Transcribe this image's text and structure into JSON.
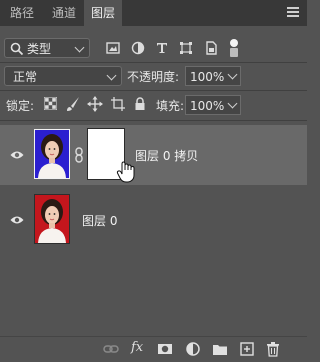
{
  "tabs": [
    {
      "label": "路径",
      "active": false
    },
    {
      "label": "通道",
      "active": false
    },
    {
      "label": "图层",
      "active": true
    }
  ],
  "filter": {
    "search_icon": "search-icon",
    "kind_label": "类型",
    "filter_icons": [
      "image-filter-icon",
      "adjustment-filter-icon",
      "type-filter-icon",
      "shape-filter-icon",
      "smart-object-filter-icon",
      "filter-toggle-icon"
    ]
  },
  "blend": {
    "mode": "正常",
    "opacity_label": "不透明度:",
    "opacity_value": "100%"
  },
  "lock": {
    "label": "锁定:",
    "icons": [
      "lock-transparent-icon",
      "lock-image-icon",
      "lock-position-icon",
      "lock-artboard-icon",
      "lock-all-icon"
    ],
    "fill_label": "填充:",
    "fill_value": "100%"
  },
  "layers": [
    {
      "name": "图层 0 拷贝",
      "visible": true,
      "selected": true,
      "background": "#2b1fd0",
      "has_mask": true
    },
    {
      "name": "图层 0",
      "visible": true,
      "selected": false,
      "background": "#c4161d",
      "has_mask": false
    }
  ],
  "colors": {
    "panel_bg": "#535353",
    "selected_layer": "#696969",
    "blue_backdrop": "#2b1fd0",
    "red_backdrop": "#c4161d"
  },
  "bottom_icons": [
    "link-layers-icon",
    "fx-icon",
    "add-mask-icon",
    "adjustment-layer-icon",
    "group-folder-icon",
    "new-layer-icon",
    "delete-icon"
  ],
  "fx_label": "fx"
}
